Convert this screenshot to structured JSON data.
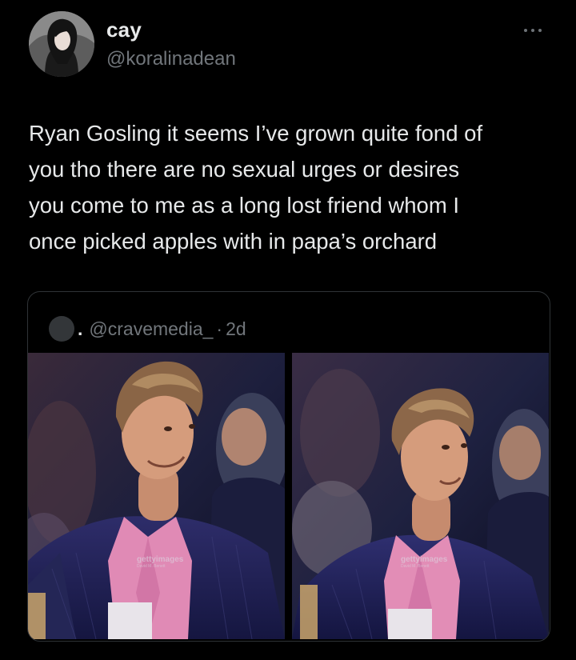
{
  "author": {
    "display_name": "cay",
    "handle": "@koralinadean"
  },
  "tweet": {
    "text": "Ryan Gosling it seems I’ve grown quite fond of\nyou tho there are no sexual urges or desires\nyou come to me as a long lost friend whom I\nonce picked apples with in papa’s orchard"
  },
  "quoted_tweet": {
    "dot": ".",
    "handle": "@cravemedia_",
    "separator": "·",
    "time": "2d",
    "media": [
      {
        "watermark": "gettyimages",
        "credit": "David M. Benett"
      },
      {
        "watermark": "gettyimages",
        "credit": "David M. Benett"
      }
    ]
  },
  "colors": {
    "background": "#000000",
    "text_primary": "#e7e9ea",
    "text_secondary": "#71767b",
    "border": "#2f3336"
  },
  "icons": {
    "more": "more-horizontal-icon"
  }
}
